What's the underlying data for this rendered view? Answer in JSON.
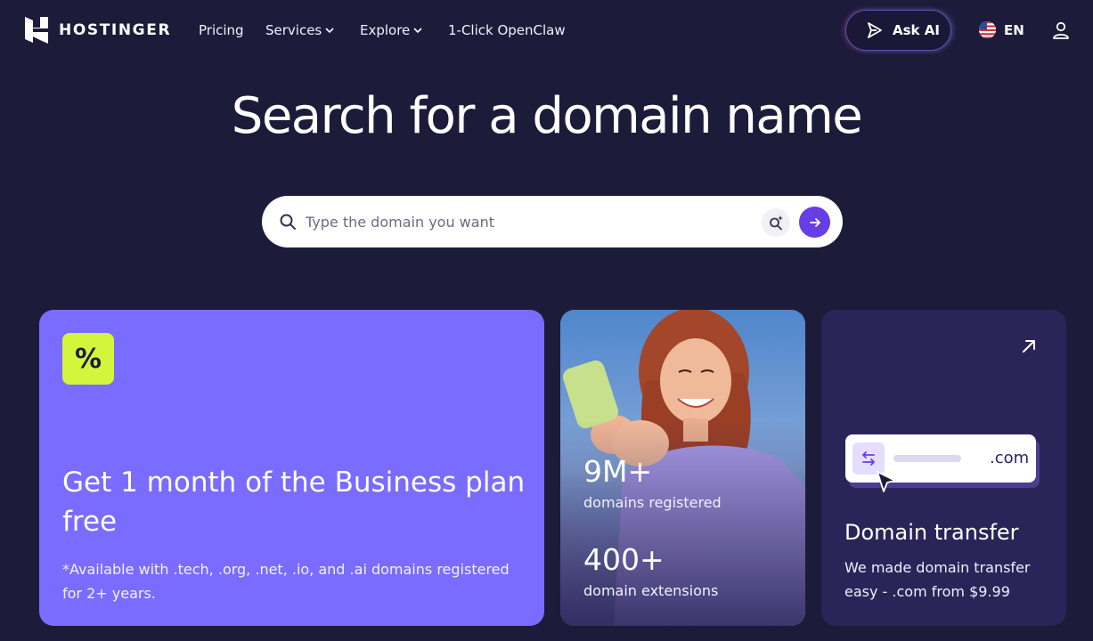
{
  "brand": {
    "name": "HOSTINGER"
  },
  "nav": {
    "links": [
      {
        "label": "Pricing",
        "has_dropdown": false
      },
      {
        "label": "Services",
        "has_dropdown": true
      },
      {
        "label": "Explore",
        "has_dropdown": true
      },
      {
        "label": "1-Click OpenClaw",
        "has_dropdown": false
      }
    ],
    "ask_ai_label": "Ask AI",
    "language_label": "EN"
  },
  "hero": {
    "title": "Search for a domain name",
    "search_placeholder": "Type the domain you want"
  },
  "promo_card": {
    "badge": "%",
    "title": "Get 1 month of the Business plan free",
    "note": "*Available with .tech, .org, .net, .io, and .ai domains registered for 2+ years."
  },
  "stats_card": {
    "stats": [
      {
        "value": "9M+",
        "label": "domains registered"
      },
      {
        "value": "400+",
        "label": "domain extensions"
      }
    ]
  },
  "transfer_card": {
    "illustration_tld": ".com",
    "title": "Domain transfer",
    "description": "We made domain transfer easy - .com from $9.99"
  },
  "colors": {
    "background": "#1d1b3a",
    "primary": "#673de6",
    "promo_card": "#7a6cff",
    "badge": "#d4f53c",
    "transfer_card": "#2a2558"
  }
}
